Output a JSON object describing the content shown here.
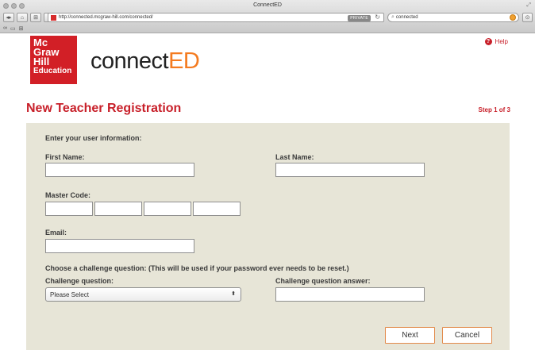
{
  "browser": {
    "window_title": "ConnectED",
    "address": "http://connected.mcgraw-hill.com/connected/",
    "private_badge": "PRIVATE",
    "search_value": "connected",
    "nav": {
      "back": "◀",
      "forward": "▶",
      "home": "⌂",
      "bookmarks": "⊞",
      "add": "+"
    }
  },
  "header": {
    "logo_lines": [
      "Mc",
      "Graw",
      "Hill",
      "Education"
    ],
    "brand_part1": "connect",
    "brand_part2": "ED",
    "help_label": "Help"
  },
  "page": {
    "title": "New Teacher Registration",
    "step": "Step 1 of 3"
  },
  "form": {
    "section_user_info": "Enter your user information:",
    "first_name_label": "First Name:",
    "last_name_label": "Last Name:",
    "master_code_label": "Master Code:",
    "email_label": "Email:",
    "challenge_intro": "Choose a challenge question: (This will be used if your password ever needs to be reset.)",
    "challenge_question_label": "Challenge question:",
    "challenge_answer_label": "Challenge question answer:",
    "challenge_select_value": "Please Select",
    "next_button": "Next",
    "cancel_button": "Cancel"
  },
  "colors": {
    "accent_red": "#c8202a",
    "brand_orange": "#f47b20",
    "panel_bg": "#e7e5d7",
    "button_border": "#e28a4a"
  }
}
